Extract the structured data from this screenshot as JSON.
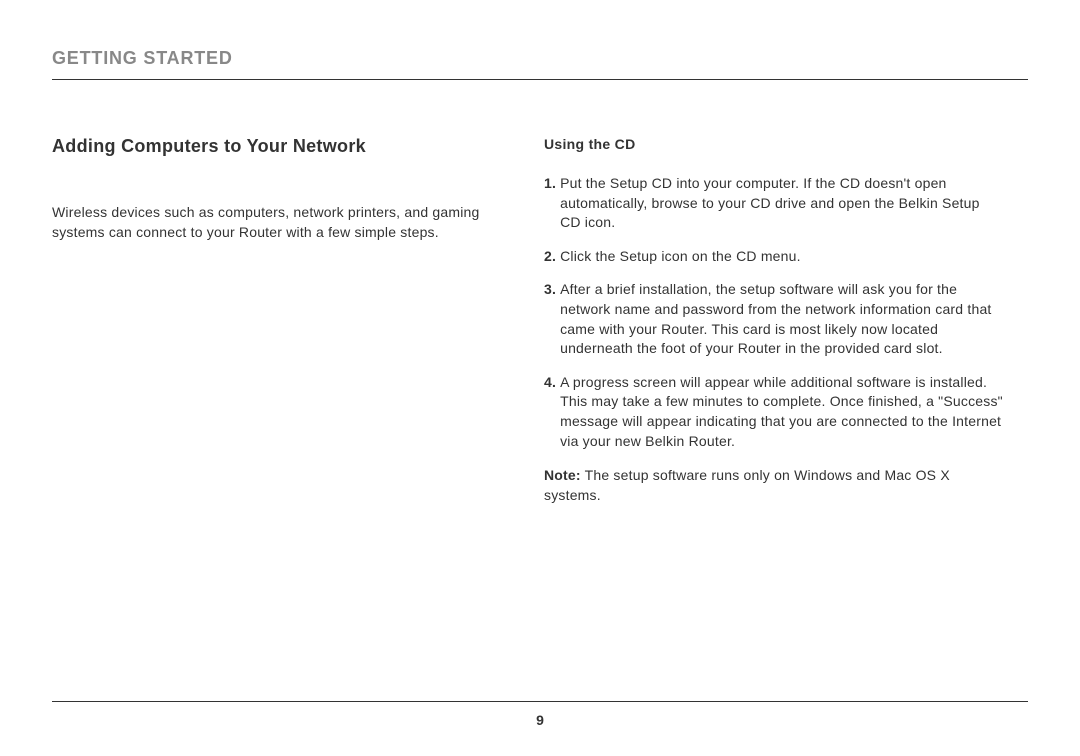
{
  "chapter_title": "GETTING STARTED",
  "main": {
    "left": {
      "heading": "Adding Computers to Your Network",
      "intro": "Wireless devices such as computers, network printers, and gaming systems can connect to your Router with a few simple steps."
    },
    "right": {
      "subheading": "Using the CD",
      "steps": [
        {
          "num": "1.",
          "text": "Put the Setup CD into your computer. If the CD doesn't open automatically, browse to your CD drive and open the Belkin Setup CD icon."
        },
        {
          "num": "2.",
          "text": "Click the Setup icon on the CD menu."
        },
        {
          "num": "3.",
          "text": "After a brief installation, the setup software will ask you for the network name and password from the network information card that came with your Router. This card is most likely now located underneath the foot of your Router in the provided card slot."
        },
        {
          "num": "4.",
          "text": "A progress screen will appear while additional software is installed. This may take a few minutes to complete. Once finished, a \"Success\" message will appear indicating that you are connected to the Internet via your new Belkin Router."
        }
      ],
      "note_label": "Note:",
      "note_text": " The setup software runs only on Windows and Mac OS X systems."
    }
  },
  "page_number": "9"
}
